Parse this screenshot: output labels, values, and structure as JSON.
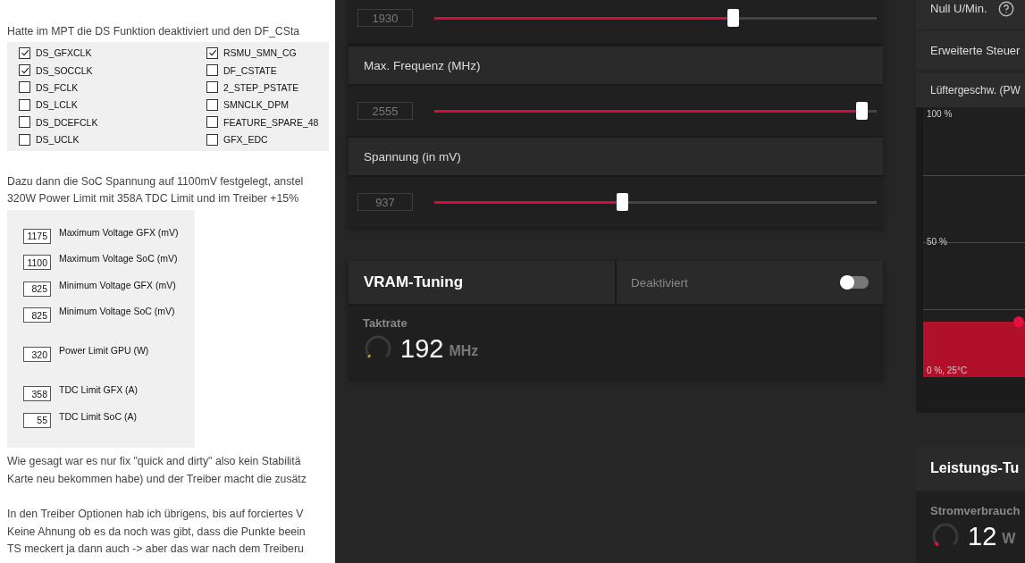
{
  "post": [
    {
      "kind": "text",
      "lines": [
        "Hatte im MPT die DS Funktion deaktiviert und den DF_CSta"
      ]
    },
    {
      "kind": "checkboxes",
      "columns": [
        [
          {
            "label": "DS_GFXCLK",
            "checked": true
          },
          {
            "label": "DS_SOCCLK",
            "checked": true
          },
          {
            "label": "DS_FCLK",
            "checked": false
          },
          {
            "label": "DS_LCLK",
            "checked": false
          },
          {
            "label": "DS_DCEFCLK",
            "checked": false
          },
          {
            "label": "DS_UCLK",
            "checked": false
          }
        ],
        [
          {
            "label": "RSMU_SMN_CG",
            "checked": true
          },
          {
            "label": "DF_CSTATE",
            "checked": false
          },
          {
            "label": "2_STEP_PSTATE",
            "checked": false
          },
          {
            "label": "SMNCLK_DPM",
            "checked": false
          },
          {
            "label": "FEATURE_SPARE_48",
            "checked": false
          },
          {
            "label": "GFX_EDC",
            "checked": false
          }
        ]
      ]
    },
    {
      "kind": "text",
      "lines": [
        "Dazu dann die SoC Spannung auf 1100mV festgelegt, anstel",
        "320W Power Limit mit 358A TDC Limit und im Treiber +15%"
      ]
    },
    {
      "kind": "fields",
      "groups": [
        [
          {
            "value": "1175",
            "label": "Maximum Voltage GFX (mV)"
          },
          {
            "value": "1100",
            "label": "Maximum Voltage SoC (mV)"
          },
          {
            "value": "825",
            "label": "Minimum Voltage GFX (mV)"
          },
          {
            "value": "825",
            "label": "Minimum Voltage SoC (mV)"
          }
        ],
        [
          {
            "value": "320",
            "label": "Power Limit GPU (W)"
          }
        ],
        [
          {
            "value": "358",
            "label": "TDC Limit GFX (A)"
          },
          {
            "value": "55",
            "label": "TDC Limit SoC (A)"
          }
        ]
      ]
    },
    {
      "kind": "text",
      "lines": [
        "Wie gesagt war es nur fix \"quick and dirty\" also kein Stabilitä",
        "Karte neu bekommen habe) und der Treiber macht die zusätz"
      ]
    },
    {
      "kind": "text",
      "lines": [
        "In den Treiber Optionen hab ich übrigens, bis auf forciertes V",
        "Keine Ahnung ob es da noch was gibt, dass die Punkte beein",
        "TS meckert ja dann auch -> aber das war nach dem Treiberu"
      ]
    }
  ],
  "clock_sliders": [
    {
      "value": "1930",
      "level": 0.677
    },
    {
      "heading": "Max. Frequenz (MHz)",
      "value": "2555",
      "level": 0.968
    },
    {
      "heading": "Spannung (in mV)",
      "value": "937",
      "level": 0.426
    }
  ],
  "vram": {
    "title": "VRAM-Tuning",
    "status": "Deaktiviert",
    "on": false,
    "metric_label": "Taktrate",
    "value": "192",
    "unit": "MHz"
  },
  "fan_panel": {
    "rows": [
      {
        "label": "Null U/Min.",
        "help": true
      },
      {
        "label": "Erweiterte Steuer",
        "help": false
      },
      {
        "label": "Lüftergeschw. (PW",
        "help": false
      }
    ],
    "axis_labels": [
      "100 %",
      "50 %",
      "0 %, 25°C"
    ]
  },
  "power": {
    "title": "Leistungs-Tu",
    "metric_label": "Stromverbrauch",
    "value": "12",
    "unit": "W"
  }
}
